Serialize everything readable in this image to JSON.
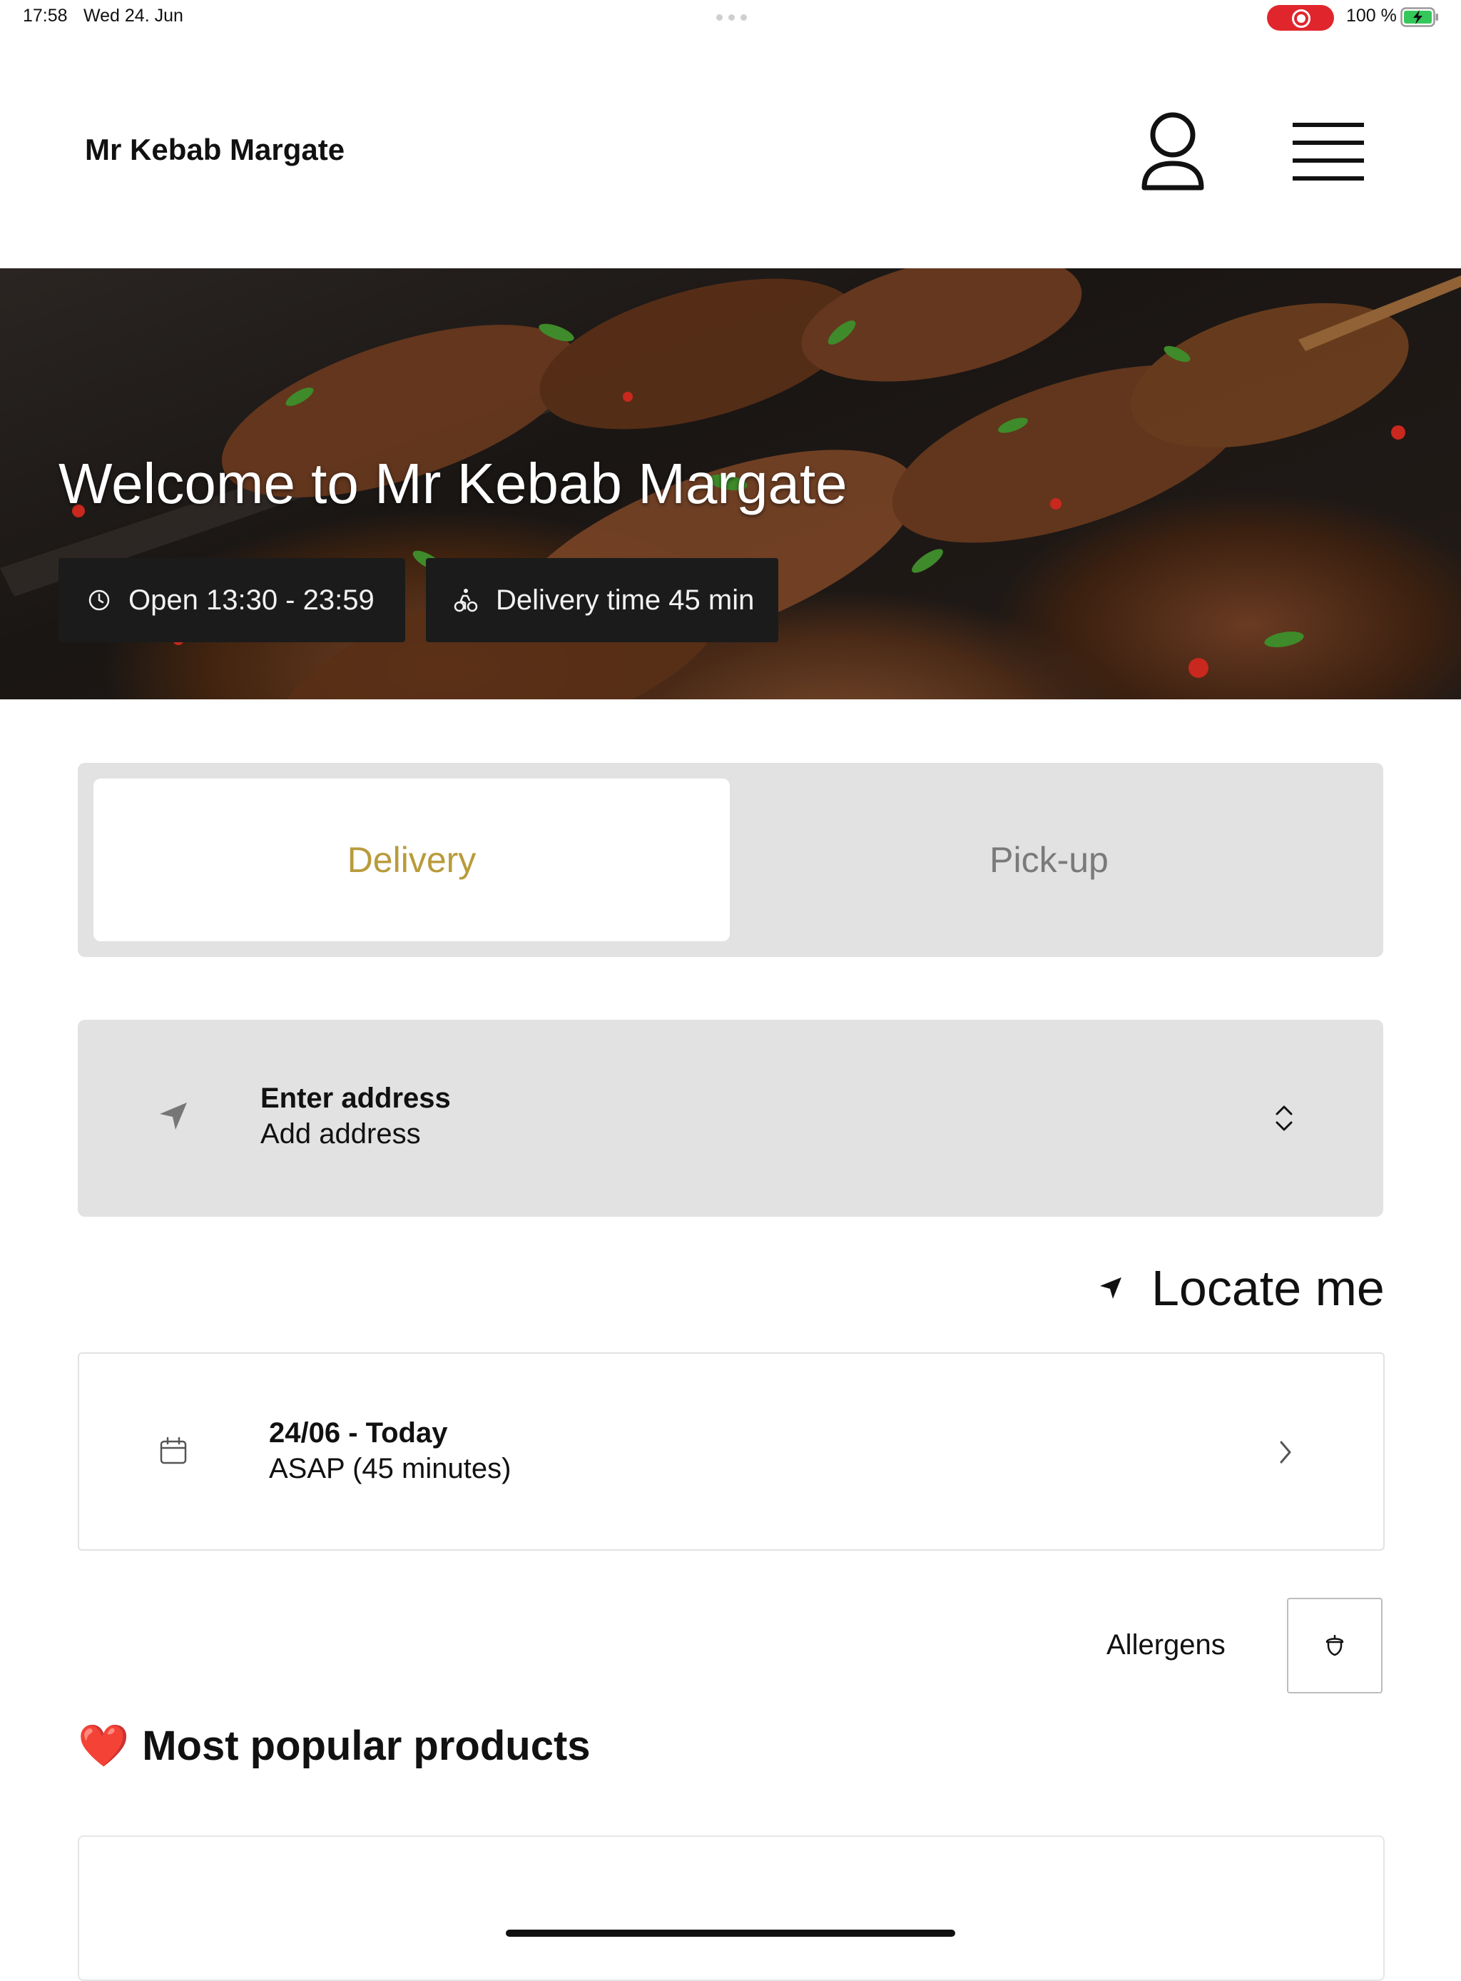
{
  "status_bar": {
    "time": "17:58",
    "date": "Wed 24. Jun",
    "battery": "100 %"
  },
  "header": {
    "brand": "Mr Kebab Margate",
    "profile_icon": "user-icon",
    "menu_icon": "hamburger-menu-icon"
  },
  "hero": {
    "title": "Welcome to Mr Kebab Margate",
    "open_hours": "Open 13:30 - 23:59",
    "delivery_time": "Delivery time 45 min"
  },
  "order_type": {
    "options": [
      "Delivery",
      "Pick-up"
    ],
    "selected": "Delivery",
    "active_color": "#b89b3b"
  },
  "address": {
    "title": "Enter address",
    "subtitle": "Add address"
  },
  "locate": {
    "label": "Locate me"
  },
  "schedule": {
    "date": "24/06 - Today",
    "time": "ASAP (45 minutes)"
  },
  "allergens": {
    "label": "Allergens"
  },
  "popular": {
    "emoji": "❤️",
    "title": "Most popular products"
  }
}
